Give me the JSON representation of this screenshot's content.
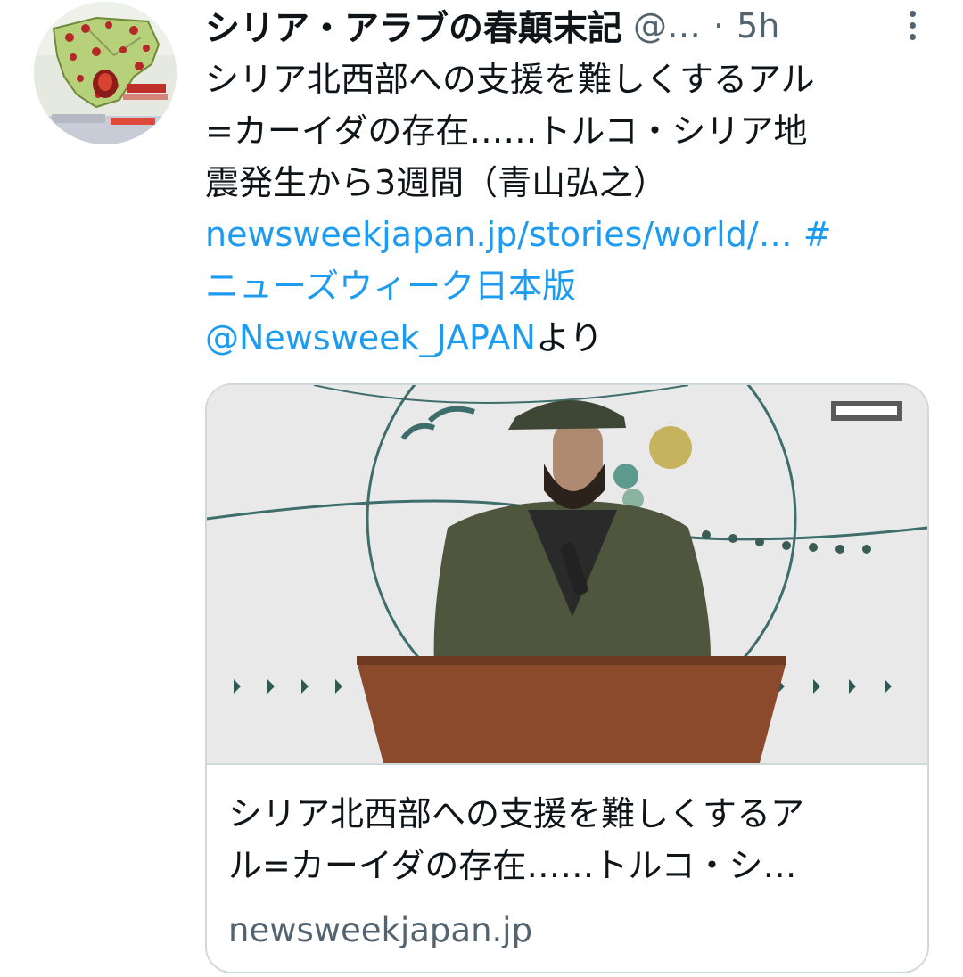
{
  "tweet": {
    "display_name": "シリア・アラブの春顛末記",
    "handle": "@…",
    "separator": "·",
    "timestamp": "5h",
    "text_line1": "シリア北西部への支援を難しくするアル",
    "text_line2": "=カーイダの存在……トルコ・シリア地",
    "text_line3": "震発生から3週間（青山弘之）",
    "link_url": "newsweekjapan.jp/stories/world/…",
    "hashtag_mark": "#",
    "hashtag_text": "ニューズウィーク日本版",
    "mention": "@Newsweek_JAPAN",
    "mention_suffix": "より"
  },
  "card": {
    "title_line1": "シリア北西部への支援を難しくするア",
    "title_line2": "ル=カーイダの存在……トルコ・シ…",
    "domain": "newsweekjapan.jp"
  },
  "icons": {
    "more": "more-vertical-icon"
  },
  "colors": {
    "link": "#1d9bf0",
    "text": "#0f1419",
    "secondary": "#536471",
    "border": "#cfd9de"
  }
}
